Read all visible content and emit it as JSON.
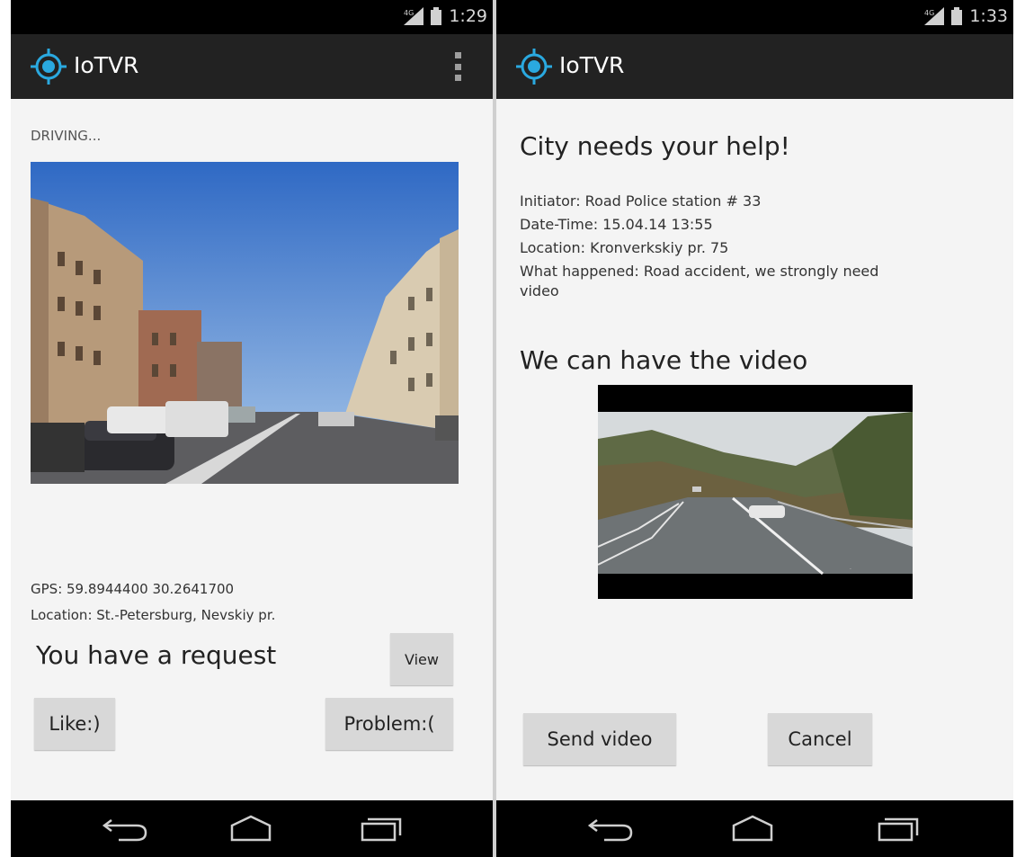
{
  "left_screen": {
    "status": {
      "time": "1:29"
    },
    "app_title": "IoTVR",
    "mode_text": "DRIVING...",
    "gps_text": "GPS: 59.8944400  30.2641700",
    "location_text": "Location: St.-Petersburg, Nevskiy pr.",
    "request_text": "You have a request",
    "view_label": "View",
    "like_label": "Like:)",
    "problem_label": "Problem:("
  },
  "right_screen": {
    "status": {
      "time": "1:33"
    },
    "app_title": "IoTVR",
    "heading": "City needs your help!",
    "details": {
      "initiator": "Initiator: Road Police station # 33",
      "datetime": "Date-Time: 15.04.14 13:55",
      "location": "Location: Kronverkskiy pr. 75",
      "what_happened": "What happened: Road accident, we strongly need",
      "what_happened_cont": "video"
    },
    "video_heading": "We can have the video",
    "send_label": "Send video",
    "cancel_label": "Cancel"
  },
  "icons": {
    "app": "crosshair-location-icon",
    "signal": "signal-icon",
    "battery": "battery-icon",
    "overflow": "overflow-menu-icon",
    "back": "back-icon",
    "home": "home-icon",
    "recents": "recent-apps-icon"
  },
  "colors": {
    "accent": "#2aa9e0",
    "bar_bg": "#222222",
    "status_bg": "#000000",
    "content_bg": "#f4f4f4",
    "button_bg": "#d8d8d8"
  }
}
